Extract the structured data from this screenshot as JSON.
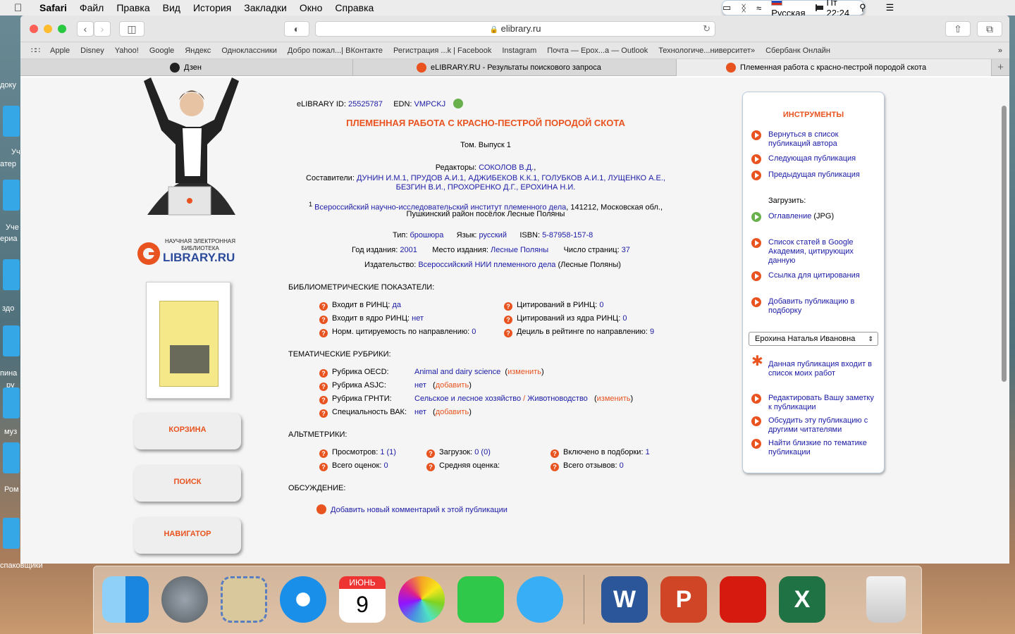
{
  "menubar": {
    "app": "Safari",
    "items": [
      "Файл",
      "Правка",
      "Вид",
      "История",
      "Закладки",
      "Окно",
      "Справка"
    ],
    "lang": "Русская",
    "clock": "Пт 22:24"
  },
  "browser": {
    "address": "elibrary.ru",
    "bookmarks": [
      "Apple",
      "Disney",
      "Yahoo!",
      "Google",
      "Яндекс",
      "Одноклассники",
      "Добро пожал...| ВКонтакте",
      "Регистрация ...k | Facebook",
      "Instagram",
      "Почта — Ерох...а — Outlook",
      "Технологиче...ниверситет»",
      "Сбербанк Онлайн"
    ],
    "tabs": [
      "Дзен",
      "eLIBRARY.RU - Результаты поискового запроса",
      "Племенная работа с красно-пестрой породой скота"
    ]
  },
  "left": {
    "logo_top": "НАУЧНАЯ ЭЛЕКТРОННАЯ",
    "logo_mid": "БИБЛИОТЕКА",
    "logo_brand": "LIBRARY.RU",
    "buttons": [
      "КОРЗИНА",
      "ПОИСК",
      "НАВИГАТОР"
    ]
  },
  "pub": {
    "id_label": "eLIBRARY ID:",
    "id": "25525787",
    "edn_label": "EDN:",
    "edn": "VMPCKJ",
    "title": "ПЛЕМЕННАЯ РАБОТА С КРАСНО-ПЕСТРОЙ ПОРОДОЙ СКОТА",
    "volume": "Том. Выпуск 1",
    "editors_label": "Редакторы:",
    "editors": "СОКОЛОВ В.Д.",
    "compilers_label": "Составители:",
    "compilers_line1": "ДУНИН И.М.1, ПРУДОВ А.И.1, АДЖИБЕКОВ К.К.1, ГОЛУБКОВ А.И.1, ЛУЩЕНКО А.Е.,",
    "compilers_line2": "БЕЗГИН В.И., ПРОХОРЕНКО Д.Г., ЕРОХИНА Н.И.",
    "aff_num": "1",
    "aff_org": "Всероссийский научно-исследовательский институт племенного дела",
    "aff_addr": ", 141212, Московская обл.,",
    "aff_line2": "Пушкинский район посёлок Лесные Поляны",
    "type_label": "Тип:",
    "type": "брошюра",
    "lang_label": "Язык:",
    "lang": "русский",
    "isbn_label": "ISBN:",
    "isbn": "5-87958-157-8",
    "year_label": "Год издания:",
    "year": "2001",
    "place_label": "Место издания:",
    "place": "Лесные Поляны",
    "pages_label": "Число страниц:",
    "pages": "37",
    "pub_label": "Издательство:",
    "publisher": "Всероссийский НИИ племенного дела",
    "pub_place": "(Лесные Поляны)"
  },
  "biblio": {
    "heading": "БИБЛИОМЕТРИЧЕСКИЕ ПОКАЗАТЕЛИ:",
    "rows": [
      {
        "label": "Входит в РИНЦ:",
        "value": "да"
      },
      {
        "label": "Входит в ядро РИНЦ:",
        "value": "нет"
      },
      {
        "label": "Норм. цитируемость по направлению:",
        "value": "0"
      },
      {
        "label": "Цитирований в РИНЦ:",
        "value": "0"
      },
      {
        "label": "Цитирований из ядра РИНЦ:",
        "value": "0"
      },
      {
        "label": "Дециль в рейтинге по направлению:",
        "value": "9"
      }
    ]
  },
  "rubrics": {
    "heading": "ТЕМАТИЧЕСКИЕ РУБРИКИ:",
    "oecd_label": "Рубрика OECD:",
    "oecd": "Animal and dairy science",
    "oecd_act": "изменить",
    "asjc_label": "Рубрика ASJC:",
    "asjc": "нет",
    "asjc_act": "добавить",
    "grnti_label": "Рубрика ГРНТИ:",
    "grnti": "Сельское и лесное хозяйство",
    "grnti_sep": "/",
    "grnti2": "Животноводство",
    "grnti_act": "изменить",
    "vak_label": "Специальность ВАК:",
    "vak": "нет",
    "vak_act": "добавить"
  },
  "alt": {
    "heading": "АЛЬТМЕТРИКИ:",
    "views_label": "Просмотров:",
    "views": "1 (1)",
    "downloads_label": "Загрузок:",
    "downloads": "0 (0)",
    "coll_label": "Включено в подборки:",
    "coll": "1",
    "ratings_label": "Всего оценок:",
    "ratings": "0",
    "avg_label": "Средняя оценка:",
    "reviews_label": "Всего отзывов:",
    "reviews": "0"
  },
  "discussion": {
    "heading": "ОБСУЖДЕНИЕ:",
    "add": "Добавить новый комментарий к этой публикации"
  },
  "tools": {
    "heading": "ИНСТРУМЕНТЫ",
    "back": "Вернуться в список публикаций автора",
    "next": "Следующая публикация",
    "prev": "Предыдущая публикация",
    "download_label": "Загрузить:",
    "toc": "Оглавление",
    "toc_fmt": "(JPG)",
    "scholar": "Список статей в Google Академия, цитирующих данную",
    "cite": "Ссылка для цитирования",
    "collection": "Добавить публикацию в подборку",
    "select": "Ерохина Наталья Ивановна",
    "mywork": "Данная публикация входит в список моих работ",
    "note": "Редактировать Вашу заметку к публикации",
    "discuss": "Обсудить эту публикацию с другими читателями",
    "similar": "Найти близкие по тематике публикации"
  },
  "desktop": {
    "labels": [
      "доку",
      "Уч",
      "атер",
      "Уче",
      "ериа",
      "здо",
      "пина",
      "ру",
      "муз",
      "Ром",
      "спаковщики"
    ]
  },
  "dock": {
    "calendar_month": "ИЮНЬ",
    "calendar_day": "9",
    "apps": [
      "finder-icon",
      "launchpad-icon",
      "mail-icon",
      "safari-icon",
      "calendar-icon",
      "photos-icon",
      "facetime-icon",
      "messages-icon",
      "word-icon",
      "powerpoint-icon",
      "acrobat-icon",
      "excel-icon",
      "trash-icon"
    ]
  }
}
